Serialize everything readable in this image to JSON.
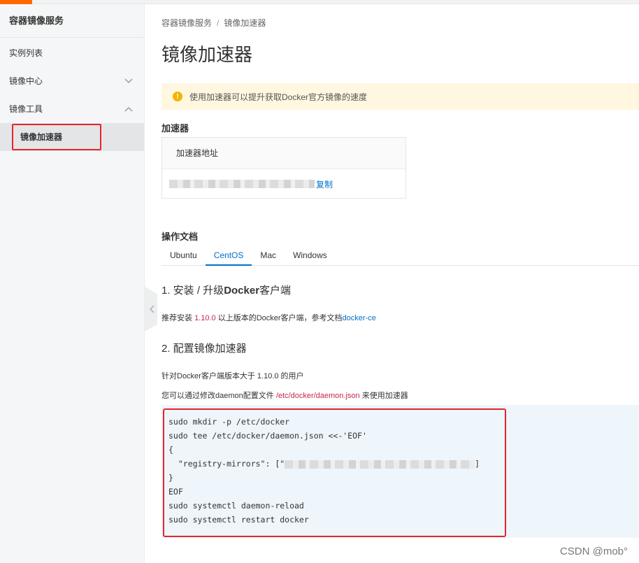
{
  "colors": {
    "accent": "#ff6a00",
    "link": "#0070cc",
    "highlight_box": "#e4262a",
    "notice_bg": "#fff7e0"
  },
  "sidebar": {
    "title": "容器镜像服务",
    "items": [
      {
        "label": "实例列表"
      },
      {
        "label": "镜像中心",
        "icon": "chevron-down-icon"
      },
      {
        "label": "镜像工具",
        "icon": "chevron-up-icon"
      }
    ],
    "sub_item": {
      "label": "镜像加速器"
    }
  },
  "breadcrumb": {
    "root": "容器镜像服务",
    "separator": "/",
    "current": "镜像加速器"
  },
  "page_title": "镜像加速器",
  "notice": {
    "icon": "warning-icon",
    "text": "使用加速器可以提升获取Docker官方镜像的速度"
  },
  "accelerator": {
    "section_title": "加速器",
    "header": "加速器地址",
    "copy_label": "复制"
  },
  "docs": {
    "section_title": "操作文档",
    "tabs": [
      "Ubuntu",
      "CentOS",
      "Mac",
      "Windows"
    ],
    "active_tab": "CentOS",
    "step1": {
      "title_prefix": "1. 安装 / 升级",
      "title_bold": "Docker",
      "title_suffix": "客户端",
      "text_prefix": "推荐安装 ",
      "version": "1.10.0",
      "text_middle": " 以上版本的Docker客户端，参考文档",
      "link": "docker-ce"
    },
    "step2": {
      "title": "2. 配置镜像加速器",
      "line1": "针对Docker客户端版本大于 1.10.0 的用户",
      "line2_prefix": "您可以通过修改daemon配置文件 ",
      "line2_path": "/etc/docker/daemon.json",
      "line2_suffix": " 来使用加速器"
    },
    "code": {
      "line1": "sudo mkdir -p /etc/docker",
      "line2": "sudo tee /etc/docker/daemon.json <<-'EOF'",
      "line3": "{",
      "line4_prefix": "  \"registry-mirrors\": [\"",
      "line4_suffix": "]",
      "line5": "}",
      "line6": "EOF",
      "line7": "sudo systemctl daemon-reload",
      "line8": "sudo systemctl restart docker"
    }
  },
  "watermark": "CSDN @mob°"
}
